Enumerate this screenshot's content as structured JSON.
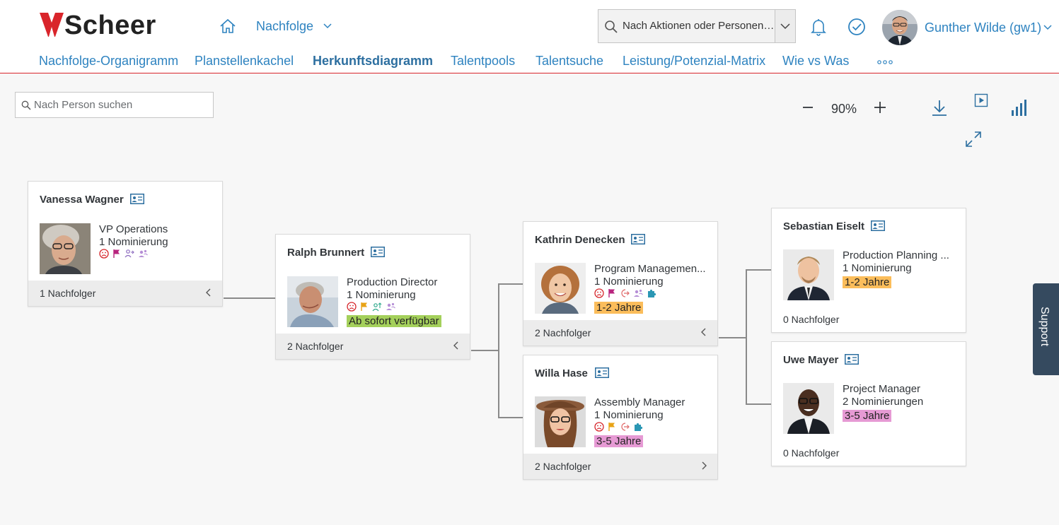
{
  "brand": {
    "name": "Scheer"
  },
  "header": {
    "app_title": "Nachfolge",
    "search_value": "Nach Aktionen oder Personen ...",
    "user_name": "Gunther Wilde (gw1)"
  },
  "tabs": [
    {
      "label": "Nachfolge-Organigramm"
    },
    {
      "label": "Planstellenkachel"
    },
    {
      "label": "Herkunftsdiagramm",
      "active": true
    },
    {
      "label": "Talentpools"
    },
    {
      "label": "Talentsuche"
    },
    {
      "label": "Leistung/Potenzial-Matrix"
    },
    {
      "label": "Wie vs Was"
    }
  ],
  "toolbar": {
    "person_search_placeholder": "Nach Person suchen",
    "zoom": "90%"
  },
  "colors": {
    "accent": "#2e83c0",
    "brand_red": "#d9252b",
    "badge_green": "#a4d05b",
    "badge_orange": "#fbbd5b",
    "badge_pink": "#e69ad4",
    "support_bg": "#354a5f"
  },
  "cards": [
    {
      "name": "Vanessa Wagner",
      "role": "VP Operations",
      "nominations": "1 Nominierung",
      "icons": [
        "sad-face-icon",
        "flag-icon",
        "person-move-icon",
        "person-group-icon"
      ],
      "badge": "",
      "footer": "1 Nachfolger",
      "footer_chevron": "left"
    },
    {
      "name": "Ralph Brunnert",
      "role": "Production Director",
      "nominations": "1 Nominierung",
      "icons": [
        "sad-face-icon",
        "flag-icon",
        "person-up-icon",
        "person-group-icon"
      ],
      "badge": "Ab sofort verfügbar",
      "badge_color": "green",
      "footer": "2 Nachfolger",
      "footer_chevron": "left"
    },
    {
      "name": "Kathrin Denecken",
      "role": "Program Managemen...",
      "nominations": "1 Nominierung",
      "icons": [
        "sad-face-icon",
        "flag-icon",
        "exit-icon",
        "person-group-icon",
        "puzzle-icon"
      ],
      "badge": "1-2 Jahre",
      "badge_color": "orange",
      "footer": "2 Nachfolger",
      "footer_chevron": "left"
    },
    {
      "name": "Willa Hase",
      "role": "Assembly Manager",
      "nominations": "1 Nominierung",
      "icons": [
        "sad-face-icon",
        "flag-icon",
        "exit-icon",
        "puzzle-icon"
      ],
      "badge": "3-5 Jahre",
      "badge_color": "pink",
      "footer": "2 Nachfolger",
      "footer_chevron": "right"
    },
    {
      "name": "Sebastian Eiselt",
      "role": "Production Planning ...",
      "nominations": "1 Nominierung",
      "icons": [],
      "badge": "1-2 Jahre",
      "badge_color": "orange",
      "footer": "0 Nachfolger",
      "footer_chevron": ""
    },
    {
      "name": "Uwe Mayer",
      "role": "Project Manager",
      "nominations": "2 Nominierungen",
      "icons": [],
      "badge": "3-5 Jahre",
      "badge_color": "pink",
      "footer": "0 Nachfolger",
      "footer_chevron": ""
    }
  ],
  "support": {
    "label": "Support"
  }
}
